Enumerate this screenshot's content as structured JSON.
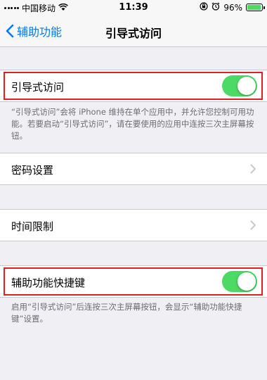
{
  "status_bar": {
    "carrier": "中国移动",
    "time": "11:39",
    "battery_percent": "96%",
    "battery_level": 0.96,
    "icons": [
      "signal-icon",
      "wifi-icon",
      "rotation-lock-icon",
      "alarm-icon",
      "battery-icon"
    ]
  },
  "nav": {
    "back_label": "辅助功能",
    "title": "引导式访问"
  },
  "rows": [
    {
      "label": "引导式访问",
      "control": "toggle",
      "on": true,
      "highlighted": true
    },
    {
      "label": "密码设置",
      "control": "chevron"
    },
    {
      "label": "时间限制",
      "control": "chevron"
    },
    {
      "label": "辅助功能快捷键",
      "control": "toggle",
      "on": true,
      "highlighted": true
    }
  ],
  "footnotes": {
    "guided_access": "“引导式访问”会将 iPhone 维持在单个应用中，并允许您控制可用功能。若要启动“引导式访问”，请在要使用的应用中连按三次主屏幕按钮。",
    "shortcut": "启用“引导式访问”后连按三次主屏幕按钮，会显示“辅助功能快捷键”设置。"
  },
  "colors": {
    "accent": "#007aff",
    "toggle_on": "#4cd964",
    "highlight_border": "#e02020",
    "background": "#efeff4"
  }
}
